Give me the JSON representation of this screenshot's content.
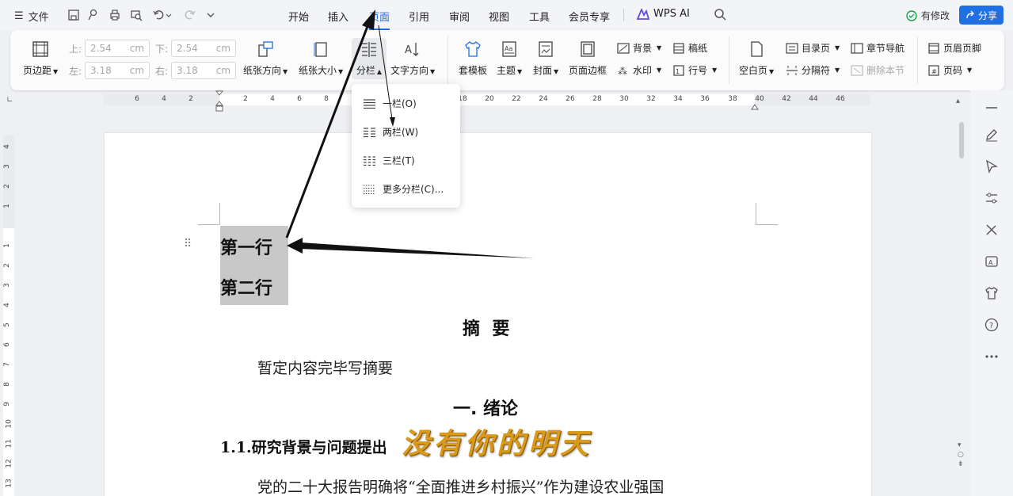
{
  "titlebar": {
    "file_label": "文件",
    "tabs": [
      "开始",
      "插入",
      "页面",
      "引用",
      "审阅",
      "视图",
      "工具",
      "会员专享"
    ],
    "active_tab": "页面",
    "ai_label": "WPS AI",
    "modified_label": "有修改",
    "share_label": "分享"
  },
  "ribbon": {
    "margins_label": "页边距",
    "top_label": "上:",
    "top_value": "2.54",
    "bottom_label": "下:",
    "bottom_value": "2.54",
    "left_label": "左:",
    "left_value": "3.18",
    "right_label": "右:",
    "right_value": "3.18",
    "unit": "cm",
    "orientation_label": "纸张方向",
    "size_label": "纸张大小",
    "columns_label": "分栏",
    "text_direction_label": "文字方向",
    "template_label": "套模板",
    "theme_label": "主题",
    "cover_label": "封面",
    "page_border_label": "页面边框",
    "background_label": "背景",
    "watermark_label": "水印",
    "draft_label": "稿纸",
    "line_number_label": "行号",
    "blank_page_label": "空白页",
    "toc_page_label": "目录页",
    "separator_label": "分隔符",
    "section_nav_label": "章节导航",
    "delete_section_label": "删除本节",
    "header_footer_label": "页眉页脚",
    "page_number_label": "页码"
  },
  "ruler": {
    "h_ticks": [
      "6",
      "4",
      "2",
      "2",
      "4",
      "6",
      "8",
      "18",
      "20",
      "22",
      "24",
      "26",
      "28",
      "30",
      "32",
      "34",
      "36",
      "38",
      "40",
      "42",
      "44",
      "46"
    ],
    "v_ticks": [
      "4",
      "3",
      "2",
      "1",
      "1",
      "2",
      "3",
      "4",
      "5",
      "6",
      "7",
      "8",
      "9",
      "10",
      "11",
      "12",
      "13"
    ]
  },
  "dropdown": {
    "items": [
      "一栏(O)",
      "两栏(W)",
      "三栏(T)",
      "更多分栏(C)..."
    ]
  },
  "document": {
    "line1": "第一行",
    "line2": "第二行",
    "abstract_title": "摘  要",
    "abstract_body": "暂定内容完毕写摘要",
    "chapter1_title": "一. 绪论",
    "section_title": "1.1.研究背景与问题提出",
    "paragraph_start": "党的二十大报告明确将“全面推进乡村振兴”作为建设农业强国",
    "watermark_text": "没有你的明天"
  },
  "colors": {
    "accent": "#1f6fe5",
    "highlight": "#c8c8c8",
    "watermark": "#d99a1c"
  }
}
